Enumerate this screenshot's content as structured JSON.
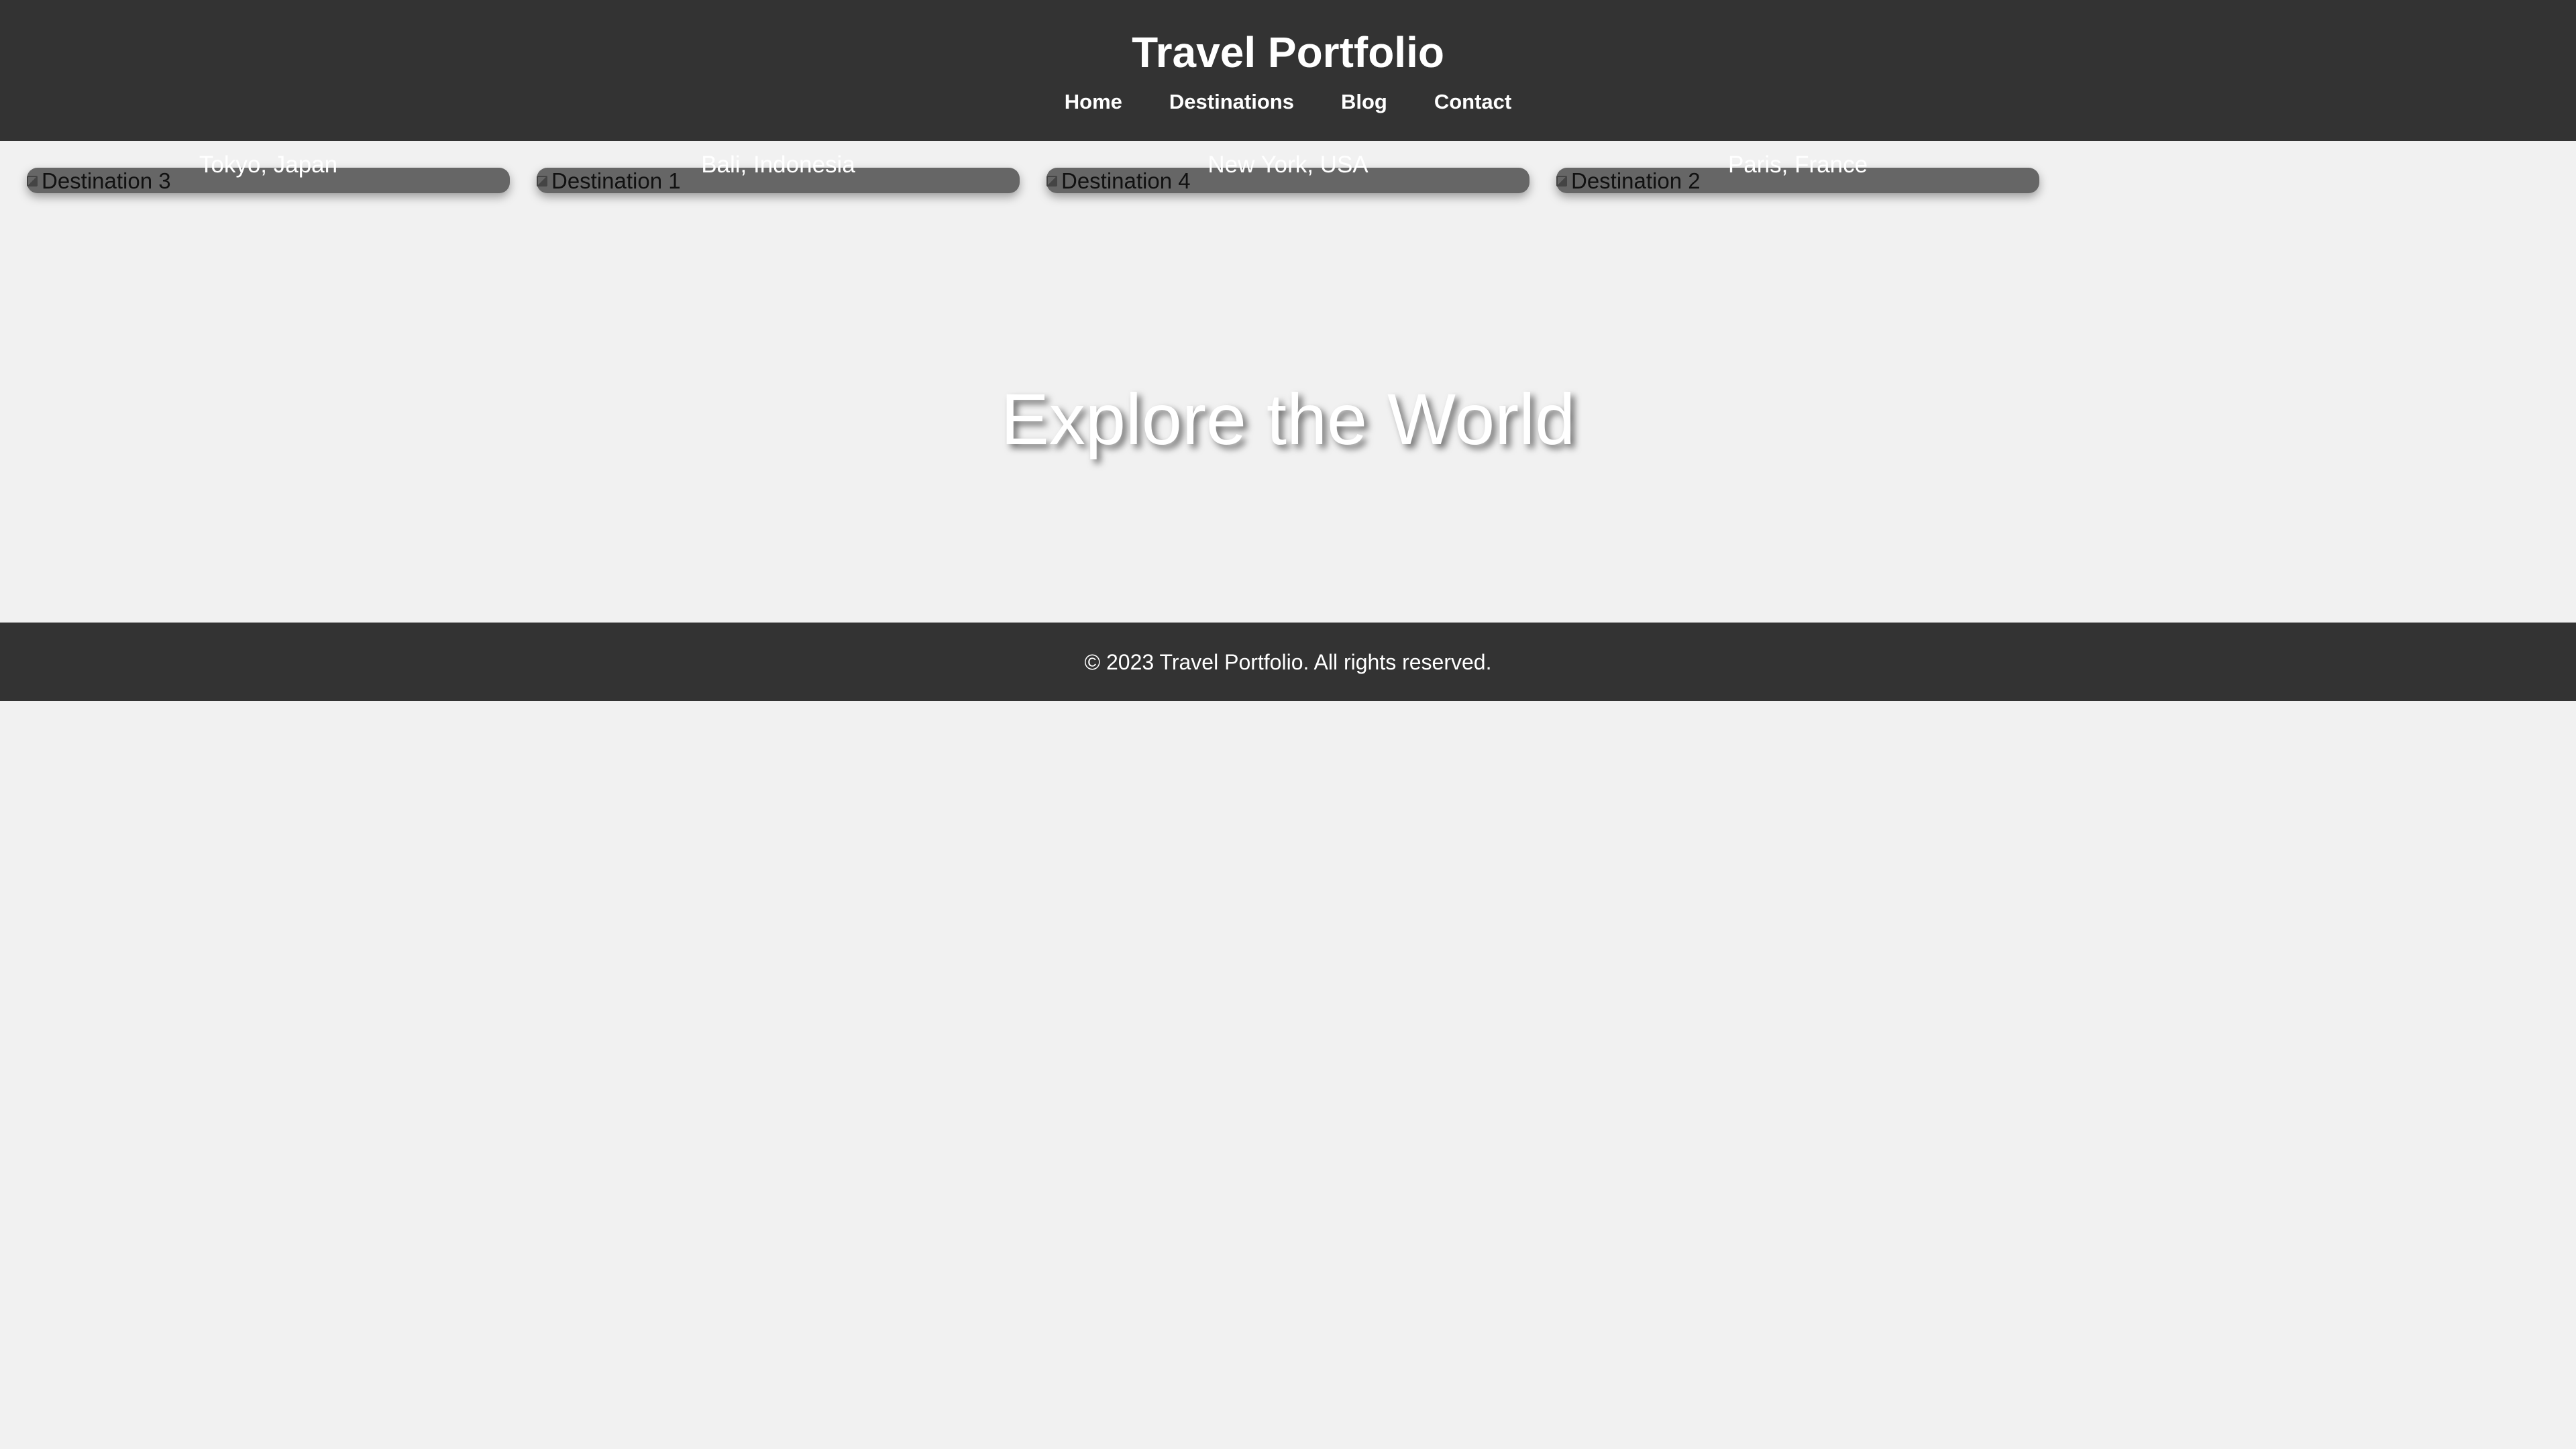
{
  "header": {
    "title": "Travel Portfolio",
    "nav": [
      "Home",
      "Destinations",
      "Blog",
      "Contact"
    ]
  },
  "gallery": {
    "cards": [
      {
        "image_alt": "Destination 3",
        "caption": "Tokyo, Japan"
      },
      {
        "image_alt": "Destination 1",
        "caption": "Bali, Indonesia"
      },
      {
        "image_alt": "Destination 4",
        "caption": "New York, USA"
      },
      {
        "image_alt": "Destination 2",
        "caption": "Paris, France"
      }
    ]
  },
  "hero": {
    "title": "Explore the World"
  },
  "footer": {
    "text": "© 2023 Travel Portfolio. All rights reserved."
  },
  "colors": {
    "header_bg": "#333333",
    "page_bg": "#f1f1f1",
    "card_bg": "#666666",
    "text_light": "#ffffff"
  }
}
